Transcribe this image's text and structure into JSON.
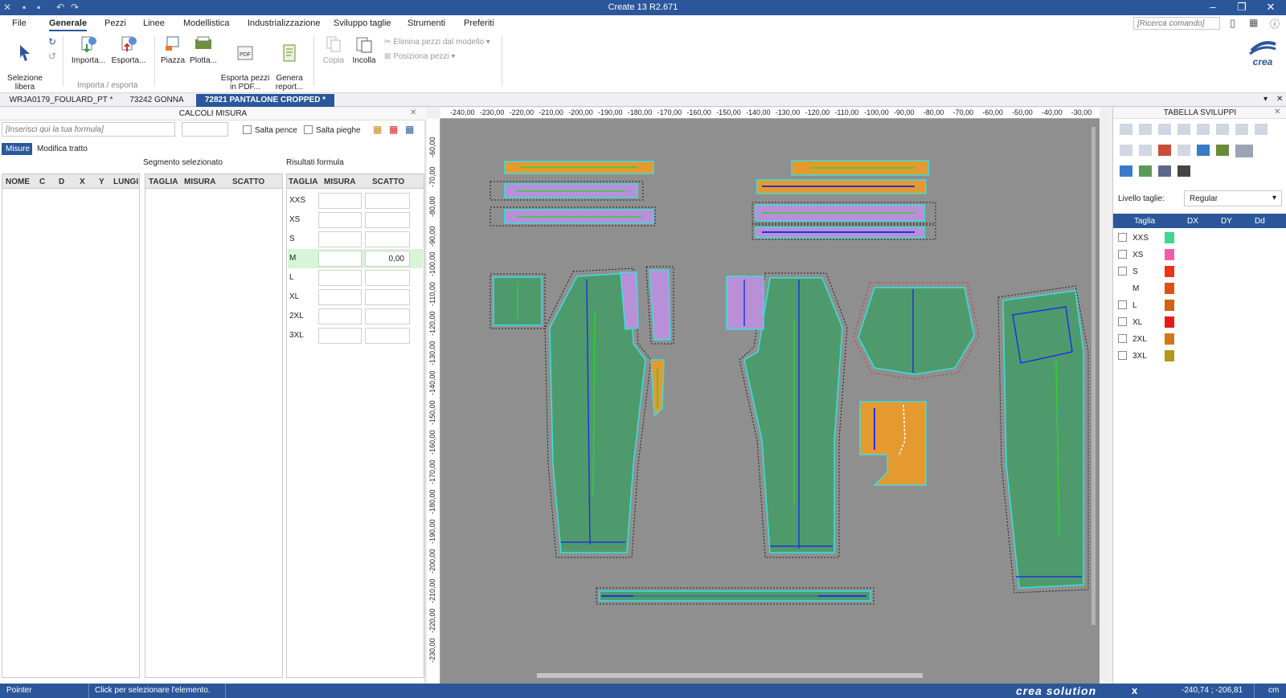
{
  "window": {
    "title": "Create 13 R2.671"
  },
  "menu": {
    "items": [
      "File",
      "Generale",
      "Pezzi",
      "Linee",
      "Modellistica",
      "Industrializzazione",
      "Sviluppo taglie",
      "Strumenti",
      "Preferiti"
    ],
    "active": "Generale",
    "search_placeholder": "[Ricerca comando]"
  },
  "ribbon": {
    "selezione": "Selezione\nlibera",
    "importa": "Importa...",
    "esporta": "Esporta...",
    "group_importa": "Importa / esporta",
    "piazza": "Piazza",
    "plotta": "Plotta...",
    "esporta_pdf": "Esporta pezzi\nin PDF...",
    "genera_report": "Genera\nreport...",
    "copia": "Copia",
    "incolla": "Incolla",
    "elimina_pezzi": "Elimina pezzi dal modello",
    "posiziona_pezzi": "Posiziona pezzi",
    "logo": "crea"
  },
  "doc_tabs": [
    "WRJA0179_FOULARD_PT *",
    "73242 GONNA",
    "72821 PANTALONE CROPPED *"
  ],
  "left_panel": {
    "title": "CALCOLI MISURA",
    "formula_placeholder": "[Inserisci qui la tua formula]",
    "salta_pence": "Salta pence",
    "salta_pieghe": "Salta pieghe",
    "tabs": [
      "Misure",
      "Modifica tratto"
    ],
    "segmento_title": "Segmento selezionato",
    "risultati_title": "Risultati formula",
    "col_a": [
      "NOME",
      "C",
      "D",
      "X",
      "Y",
      "LUNGI"
    ],
    "col_b": [
      "TAGLIA",
      "MISURA",
      "SCATTO"
    ],
    "col_c": [
      "TAGLIA",
      "MISURA",
      "SCATTO"
    ],
    "sizes": [
      {
        "size": "XXS",
        "misura": "",
        "scatto": ""
      },
      {
        "size": "XS",
        "misura": "",
        "scatto": ""
      },
      {
        "size": "S",
        "misura": "",
        "scatto": ""
      },
      {
        "size": "M",
        "misura": "",
        "scatto": "0,00"
      },
      {
        "size": "L",
        "misura": "",
        "scatto": ""
      },
      {
        "size": "XL",
        "misura": "",
        "scatto": ""
      },
      {
        "size": "2XL",
        "misura": "",
        "scatto": ""
      },
      {
        "size": "3XL",
        "misura": "",
        "scatto": ""
      }
    ]
  },
  "ruler": {
    "top": [
      "-240,00",
      "-230,00",
      "-220,00",
      "-210,00",
      "-200,00",
      "-190,00",
      "-180,00",
      "-170,00",
      "-160,00",
      "-150,00",
      "-140,00",
      "-130,00",
      "-120,00",
      "-110,00",
      "-100,00",
      "-90,00",
      "-80,00",
      "-70,00",
      "-60,00",
      "-50,00",
      "-40,00",
      "-30,00"
    ],
    "left": [
      "-60,00",
      "-70,00",
      "-80,00",
      "-90,00",
      "-100,00",
      "-110,00",
      "-120,00",
      "-130,00",
      "-140,00",
      "-150,00",
      "-160,00",
      "-170,00",
      "-180,00",
      "-190,00",
      "-200,00",
      "-210,00",
      "-220,00",
      "-230,00"
    ]
  },
  "right_panel": {
    "title": "TABELLA SVILUPPI",
    "livello_label": "Livello taglie:",
    "livello_value": "Regular",
    "headers": [
      "Taglia",
      "DX",
      "DY",
      "Dd"
    ],
    "sizes": [
      {
        "name": "XXS",
        "color": "#3cd68e",
        "checkbox": true
      },
      {
        "name": "XS",
        "color": "#ee5fa7",
        "checkbox": true
      },
      {
        "name": "S",
        "color": "#e6361c",
        "checkbox": true
      },
      {
        "name": "M",
        "color": "#d4541a",
        "checkbox": false
      },
      {
        "name": "L",
        "color": "#cc6318",
        "checkbox": true
      },
      {
        "name": "XL",
        "color": "#e81b1b",
        "checkbox": true
      },
      {
        "name": "2XL",
        "color": "#c97c17",
        "checkbox": true
      },
      {
        "name": "3XL",
        "color": "#b3961b",
        "checkbox": true
      }
    ]
  },
  "status": {
    "mode": "Pointer",
    "message": "Click per selezionare l'elemento.",
    "brand": "crea solution",
    "coords": "-240,74 ; -206,81",
    "units": "cm"
  },
  "colors": {
    "accent": "#2b579a",
    "piece_green": "#4f9a6c",
    "piece_orange": "#e49a2f",
    "piece_purple": "#b990d8",
    "canvas_bg": "#8f8f8f"
  }
}
